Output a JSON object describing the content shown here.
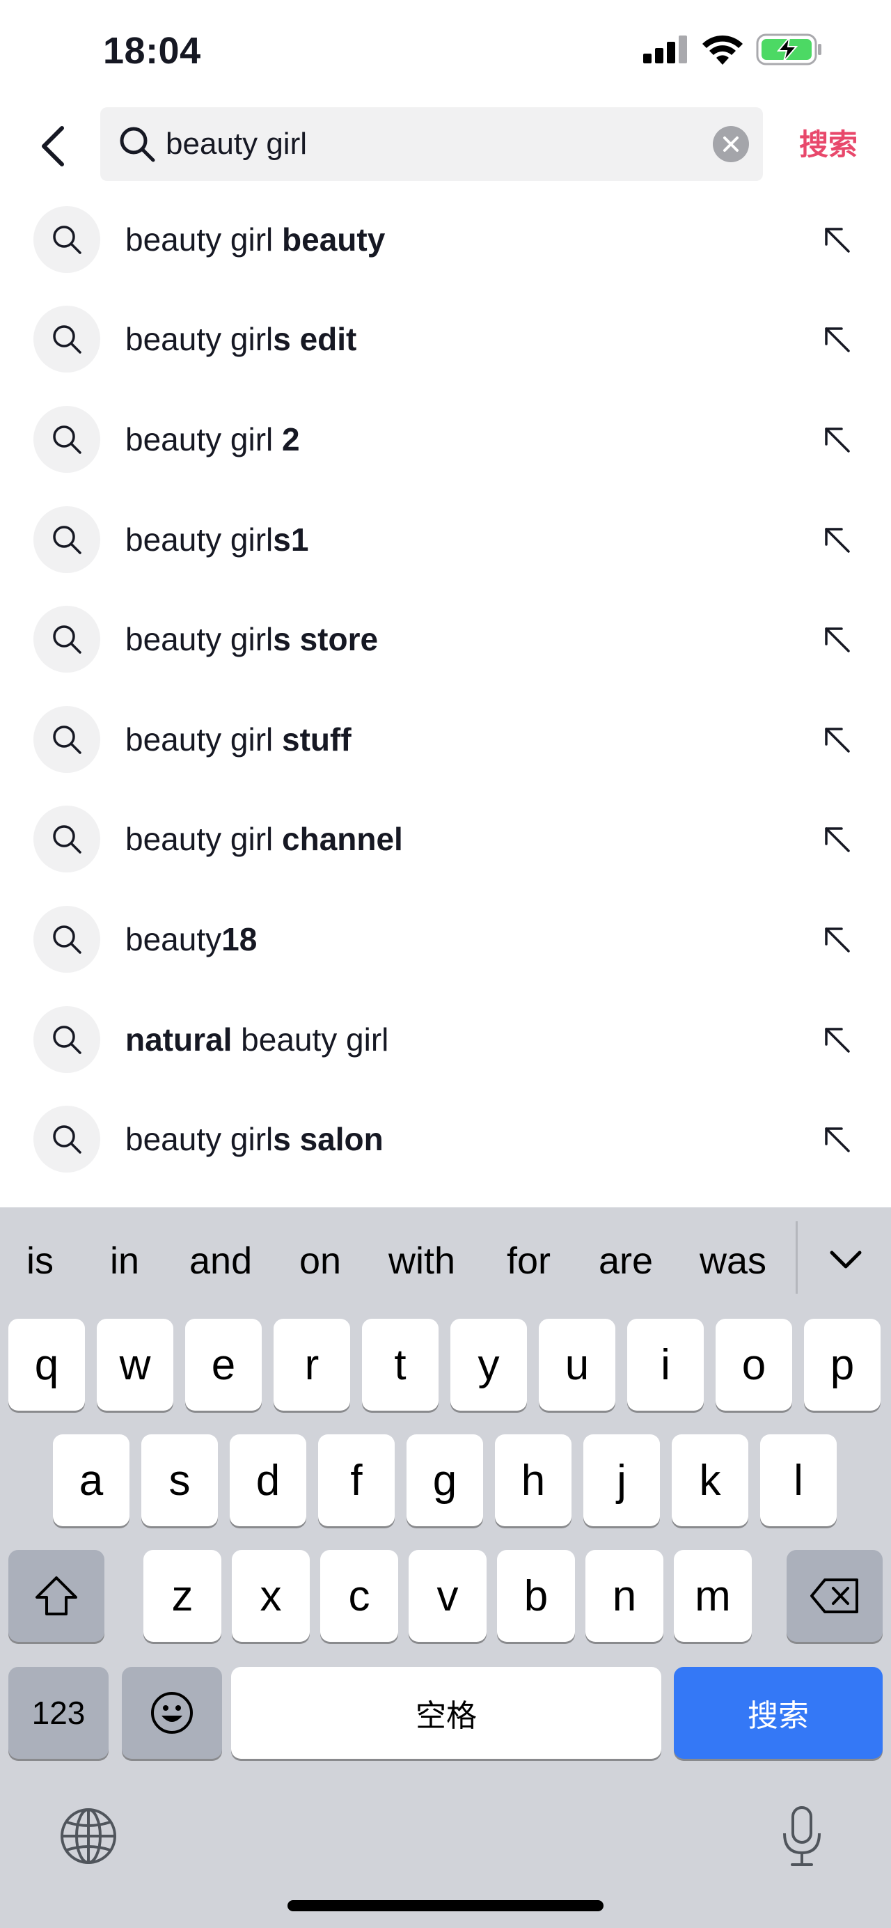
{
  "status_bar": {
    "time": "18:04",
    "icons": [
      "cellular-signal-icon",
      "wifi-icon",
      "battery-charging-icon"
    ],
    "battery_color": "#4cd964"
  },
  "search": {
    "query": "beauty girl",
    "submit_label": "搜索",
    "accent_color": "#e8486b"
  },
  "suggestions": [
    {
      "parts": [
        {
          "text": "beauty girl ",
          "bold": false
        },
        {
          "text": "beauty",
          "bold": true
        }
      ]
    },
    {
      "parts": [
        {
          "text": "beauty girl",
          "bold": false
        },
        {
          "text": "s edit",
          "bold": true
        }
      ]
    },
    {
      "parts": [
        {
          "text": "beauty girl ",
          "bold": false
        },
        {
          "text": "2",
          "bold": true
        }
      ]
    },
    {
      "parts": [
        {
          "text": "beauty girl",
          "bold": false
        },
        {
          "text": "s1",
          "bold": true
        }
      ]
    },
    {
      "parts": [
        {
          "text": "beauty girl",
          "bold": false
        },
        {
          "text": "s store",
          "bold": true
        }
      ]
    },
    {
      "parts": [
        {
          "text": "beauty girl ",
          "bold": false
        },
        {
          "text": "stuff",
          "bold": true
        }
      ]
    },
    {
      "parts": [
        {
          "text": "beauty girl ",
          "bold": false
        },
        {
          "text": "channel",
          "bold": true
        }
      ]
    },
    {
      "parts": [
        {
          "text": "beauty",
          "bold": false
        },
        {
          "text": "18",
          "bold": true
        }
      ]
    },
    {
      "parts": [
        {
          "text": "natural",
          "bold": true
        },
        {
          "text": " beauty girl",
          "bold": false
        }
      ]
    },
    {
      "parts": [
        {
          "text": "beauty girl",
          "bold": false
        },
        {
          "text": "s salon",
          "bold": true
        }
      ]
    }
  ],
  "keyboard": {
    "predictions": [
      "is",
      "in",
      "and",
      "on",
      "with",
      "for",
      "are",
      "was"
    ],
    "row1": [
      "q",
      "w",
      "e",
      "r",
      "t",
      "y",
      "u",
      "i",
      "o",
      "p"
    ],
    "row2": [
      "a",
      "s",
      "d",
      "f",
      "g",
      "h",
      "j",
      "k",
      "l"
    ],
    "row3": [
      "z",
      "x",
      "c",
      "v",
      "b",
      "n",
      "m"
    ],
    "numbers_label": "123",
    "space_label": "空格",
    "return_label": "搜索",
    "return_color": "#3478f6"
  }
}
